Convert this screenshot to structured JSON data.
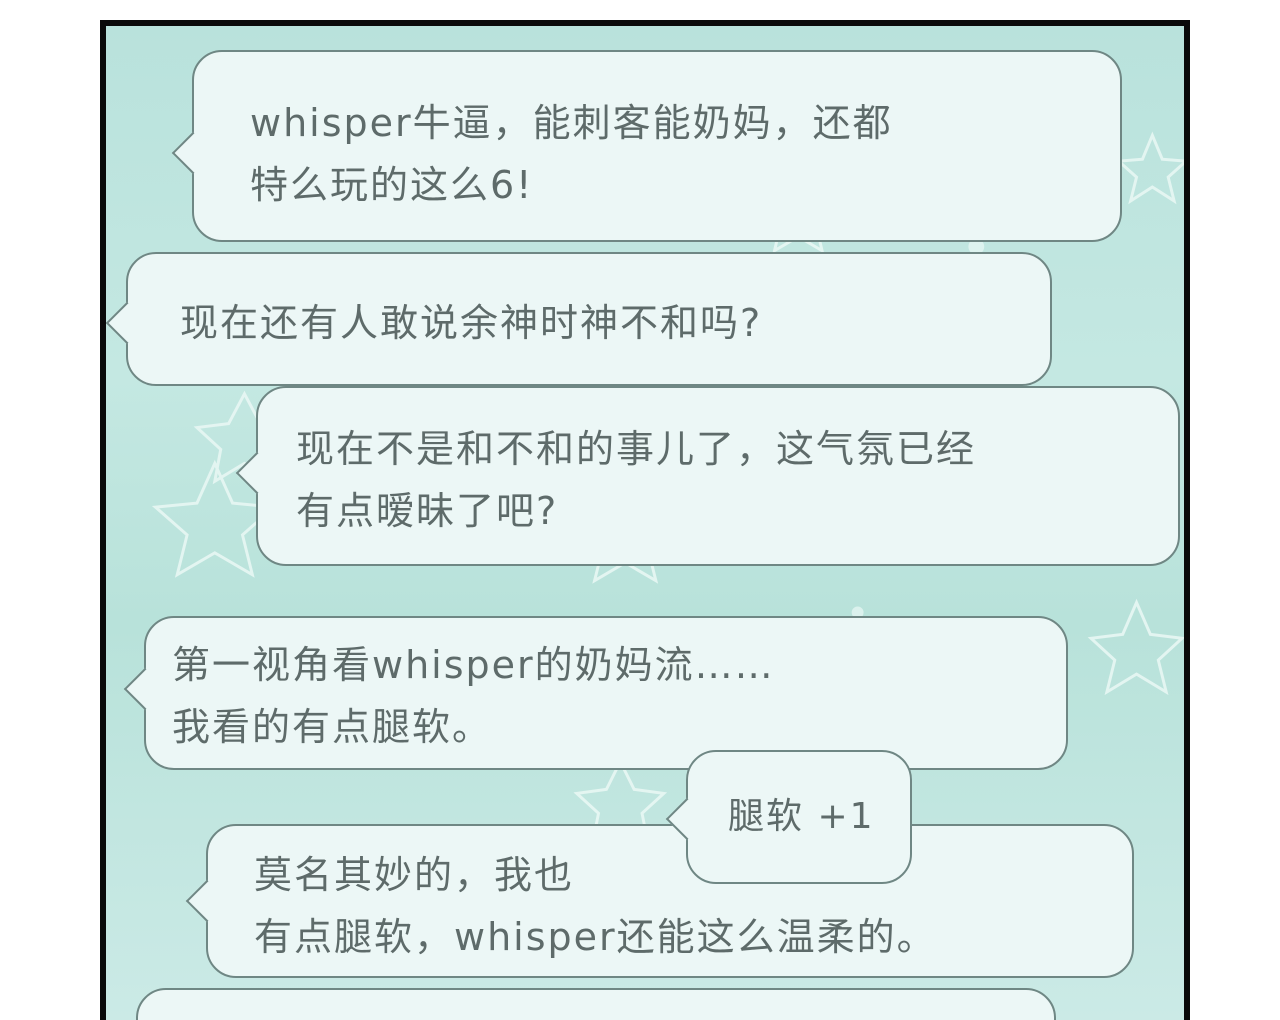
{
  "comments": [
    {
      "lines": [
        "whisper牛逼，能刺客能奶妈，还都",
        "特么玩的这么6!"
      ]
    },
    {
      "lines": [
        "现在还有人敢说余神时神不和吗?"
      ]
    },
    {
      "lines": [
        "现在不是和不和的事儿了，这气氛已经",
        "有点暧昧了吧?"
      ]
    },
    {
      "lines": [
        "第一视角看whisper的奶妈流……",
        "我看的有点腿软。"
      ]
    },
    {
      "lines": [
        "腿软 +1"
      ]
    },
    {
      "lines": [
        "莫名其妙的，我也",
        "有点腿软，whisper还能这么温柔的。"
      ]
    }
  ],
  "colors": {
    "panel_border": "#0a0a0a",
    "background": "#bfe5df",
    "bubble_fill": "#ecf7f6",
    "bubble_border": "#6f8784",
    "text": "#5e6b6a"
  }
}
